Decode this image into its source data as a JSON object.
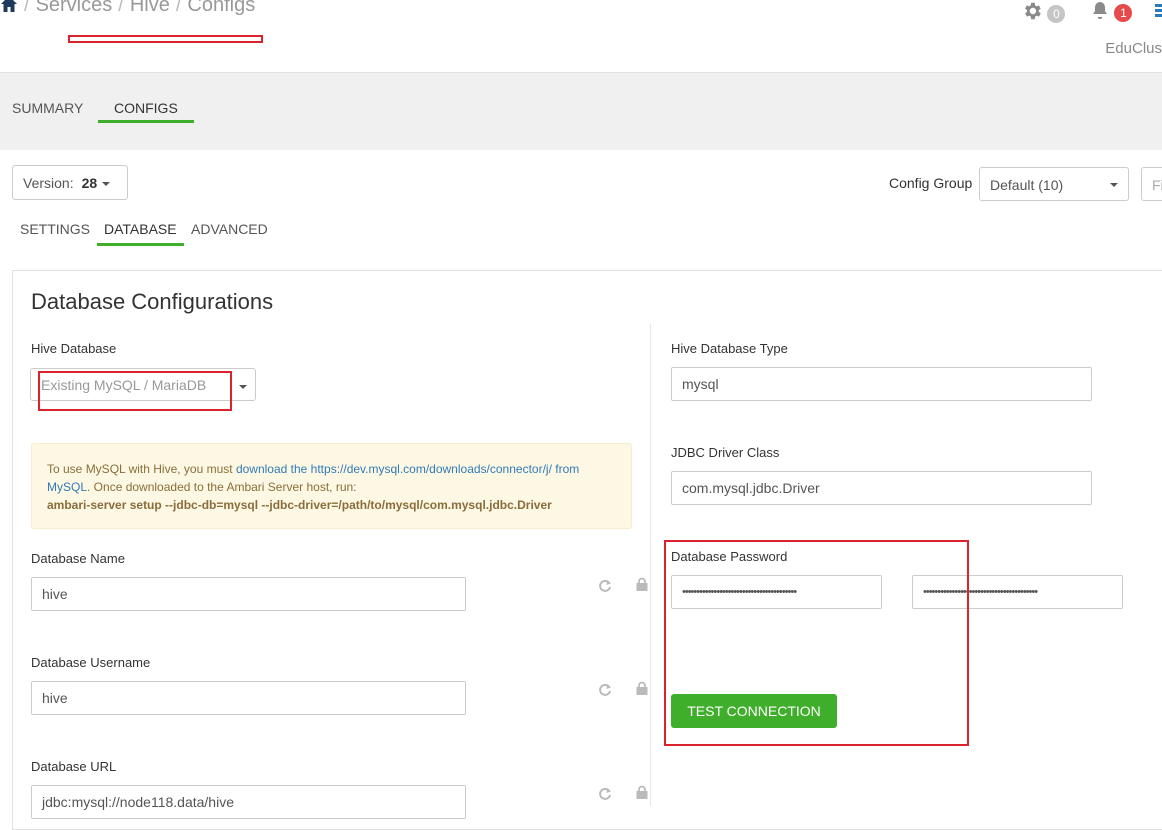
{
  "header": {
    "breadcrumb": [
      "Services",
      "Hive",
      "Configs"
    ],
    "alerts_count": "0",
    "notifications_count": "1",
    "cluster_name": "EduClus"
  },
  "service_tabs": [
    {
      "label": "SUMMARY",
      "active": false
    },
    {
      "label": "CONFIGS",
      "active": true
    }
  ],
  "version": {
    "label": "Version:",
    "value": "28"
  },
  "config_group": {
    "label": "Config Group",
    "value": "Default (10)",
    "filter_placeholder": "Fi"
  },
  "sub_tabs": [
    {
      "label": "SETTINGS",
      "active": false
    },
    {
      "label": "DATABASE",
      "active": true
    },
    {
      "label": "ADVANCED",
      "active": false
    }
  ],
  "panel": {
    "title": "Database Configurations",
    "left": {
      "hive_database": {
        "label": "Hive Database",
        "value": "Existing MySQL / MariaDB"
      },
      "alert": {
        "text_1": "To use MySQL with Hive, you must ",
        "link_1": "download the https://dev.mysql.com/downloads/connector/j/ from MySQL",
        "text_2": ". Once downloaded to the Ambari Server host, run:",
        "command": "ambari-server setup --jdbc-db=mysql --jdbc-driver=/path/to/mysql/com.mysql.jdbc.Driver"
      },
      "database_name": {
        "label": "Database Name",
        "value": "hive"
      },
      "database_username": {
        "label": "Database Username",
        "value": "hive"
      },
      "database_url": {
        "label": "Database URL",
        "value": "jdbc:mysql://node118.data/hive"
      }
    },
    "right": {
      "hive_database_type": {
        "label": "Hive Database Type",
        "value": "mysql"
      },
      "jdbc_driver_class": {
        "label": "JDBC Driver Class",
        "value": "com.mysql.jdbc.Driver"
      },
      "database_password": {
        "label": "Database Password",
        "value": "••••••••••••••••••••••••••••••••••••••••",
        "confirm_value": "••••••••••••••••••••••••••••••••••••••••"
      },
      "test_connection_label": "TEST CONNECTION"
    }
  },
  "colors": {
    "accent_green": "#3fae2a",
    "highlight_red": "#d9232e",
    "alert_bg": "#fcf8e3",
    "notification_red": "#e64a4a"
  }
}
